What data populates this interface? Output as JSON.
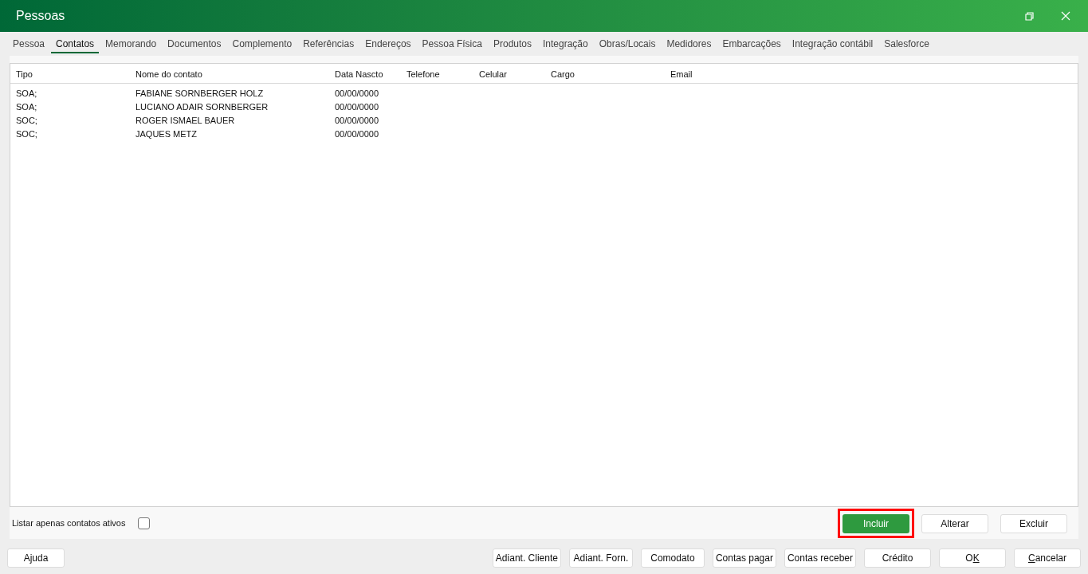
{
  "window": {
    "title": "Pessoas"
  },
  "tabs": [
    {
      "label": "Pessoa",
      "selected": false
    },
    {
      "label": "Contatos",
      "selected": true
    },
    {
      "label": "Memorando",
      "selected": false
    },
    {
      "label": "Documentos",
      "selected": false
    },
    {
      "label": "Complemento",
      "selected": false
    },
    {
      "label": "Referências",
      "selected": false
    },
    {
      "label": "Endereços",
      "selected": false
    },
    {
      "label": "Pessoa Física",
      "selected": false
    },
    {
      "label": "Produtos",
      "selected": false
    },
    {
      "label": "Integração",
      "selected": false
    },
    {
      "label": "Obras/Locais",
      "selected": false
    },
    {
      "label": "Medidores",
      "selected": false
    },
    {
      "label": "Embarcações",
      "selected": false
    },
    {
      "label": "Integração contábil",
      "selected": false
    },
    {
      "label": "Salesforce",
      "selected": false
    }
  ],
  "table": {
    "columns": [
      "Tipo",
      "Nome do contato",
      "Data Nascto",
      "Telefone",
      "Celular",
      "Cargo",
      "Email"
    ],
    "rows": [
      [
        "SOA;",
        "FABIANE SORNBERGER HOLZ",
        "00/00/0000"
      ],
      [
        "SOA;",
        "LUCIANO ADAIR SORNBERGER",
        "00/00/0000"
      ],
      [
        "SOC;",
        "ROGER ISMAEL BAUER",
        "00/00/0000"
      ],
      [
        "SOC;",
        "JAQUES METZ",
        "00/00/0000"
      ]
    ]
  },
  "filter": {
    "label": "Listar apenas contatos ativos",
    "checked": false
  },
  "row_buttons": [
    {
      "label": "Incluir",
      "kind": "primary",
      "highlighted": true
    },
    {
      "label": "Alterar",
      "kind": "normal",
      "highlighted": false
    },
    {
      "label": "Excluir",
      "kind": "normal",
      "highlighted": false
    }
  ],
  "footer_left": [
    {
      "label": "Ajuda"
    }
  ],
  "footer_right": [
    {
      "label": "Adiant. Cliente"
    },
    {
      "label": "Adiant. Forn."
    },
    {
      "label": "Comodato"
    },
    {
      "label": "Contas pagar"
    },
    {
      "label": "Contas receber"
    },
    {
      "label": "Crédito"
    },
    {
      "pre": "O",
      "key": "K"
    },
    {
      "key": "C",
      "post": "ancelar"
    }
  ]
}
